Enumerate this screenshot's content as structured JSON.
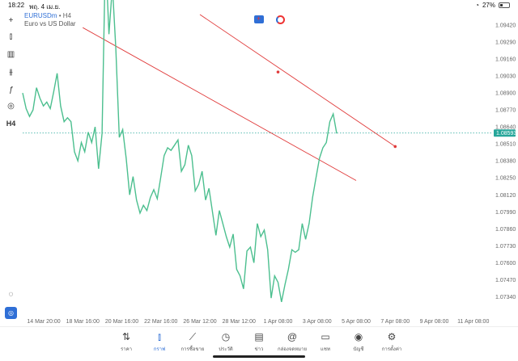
{
  "status_bar": {
    "time": "18:22",
    "date": "พฤ. 4 เม.ย.",
    "battery": "27%"
  },
  "toolbar": {
    "items": [
      "crosshair-icon",
      "candles-icon",
      "bars-chart-icon",
      "indicators-icon",
      "function-icon",
      "shapes-icon"
    ],
    "timeframe": "H4"
  },
  "symbol": {
    "name": "EURUSDm",
    "timeframe": "H4",
    "description": "Euro vs US Dollar"
  },
  "current_price": "1.08593",
  "colors": {
    "line": "#4cbf8f",
    "trendline": "#e03a3a",
    "accent": "#2f6fd6",
    "price_tag": "#26a69a"
  },
  "chart_data": {
    "type": "line",
    "series": [
      {
        "values": [
          1.089,
          1.0878,
          1.0872,
          1.0877,
          1.0894,
          1.0886,
          1.088,
          1.0883,
          1.0878,
          1.0891,
          1.0905,
          1.088,
          1.0868,
          1.0871,
          1.0868,
          1.0845,
          1.0838,
          1.0852,
          1.0845,
          1.086,
          1.0852,
          1.0864,
          1.0832,
          1.0859,
          1.0998,
          1.0935,
          1.0972,
          1.0924,
          1.0856,
          1.0862,
          1.084,
          1.0812,
          1.0826,
          1.0808,
          1.0798,
          1.0804,
          1.08,
          1.081,
          1.0816,
          1.0809,
          1.0825,
          1.0842,
          1.0848,
          1.0846,
          1.085,
          1.0854,
          1.083,
          1.0835,
          1.085,
          1.0842,
          1.0815,
          1.082,
          1.083,
          1.0808,
          1.0817,
          1.0799,
          1.0781,
          1.08,
          1.079,
          1.078,
          1.0772,
          1.0782,
          1.0755,
          1.075,
          1.074,
          1.0769,
          1.0772,
          1.076,
          1.079,
          1.078,
          1.0785,
          1.077,
          1.0733,
          1.075,
          1.0745,
          1.073,
          1.0743,
          1.0755,
          1.077,
          1.0768,
          1.077,
          1.079,
          1.0778,
          1.079,
          1.081,
          1.0825,
          1.084,
          1.0848,
          1.0852,
          1.0868,
          1.0874,
          1.0859
        ]
      }
    ],
    "x_ticks": [
      "14 Mar 20:00",
      "18 Mar 16:00",
      "20 Mar 16:00",
      "22 Mar 16:00",
      "26 Mar 12:00",
      "28 Mar 12:00",
      "1 Apr 08:00",
      "3 Apr 08:00",
      "5 Apr 08:00",
      "7 Apr 08:00",
      "9 Apr 08:00",
      "11 Apr 08:00"
    ],
    "y_ticks": [
      "1.09420",
      "1.09290",
      "1.09160",
      "1.09030",
      "1.08900",
      "1.08770",
      "1.08640",
      "1.08510",
      "1.08380",
      "1.08250",
      "1.08120",
      "1.07990",
      "1.07860",
      "1.07730",
      "1.07600",
      "1.07470",
      "1.07340"
    ],
    "ylim": [
      1.0725,
      1.095
    ],
    "trendlines": [
      {
        "start": [
          "18 Mar 16:00",
          1.094
        ],
        "end": [
          "5 Apr 08:00",
          1.0823
        ]
      },
      {
        "start": [
          "26 Mar 12:00",
          1.095
        ],
        "end": [
          "7 Apr 08:00",
          1.0849
        ],
        "marker": [
          "1 Apr 08:00",
          1.0906
        ]
      }
    ]
  },
  "bottom_nav": [
    {
      "icon": "quotes-icon",
      "label": "ราคา"
    },
    {
      "icon": "chart-icon",
      "label": "กราฟ",
      "active": true
    },
    {
      "icon": "trade-icon",
      "label": "การซื้อขาย"
    },
    {
      "icon": "history-icon",
      "label": "ประวัติ"
    },
    {
      "icon": "news-icon",
      "label": "ข่าว"
    },
    {
      "icon": "mailbox-icon",
      "label": "กล่องจดหมาย"
    },
    {
      "icon": "chat-icon",
      "label": "แชท"
    },
    {
      "icon": "account-icon",
      "label": "บัญชี"
    },
    {
      "icon": "settings-icon",
      "label": "การตั้งค่า"
    }
  ]
}
